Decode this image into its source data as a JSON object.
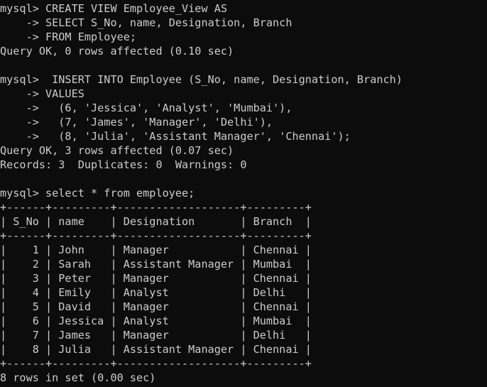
{
  "terminal": {
    "lines": [
      "mysql> CREATE VIEW Employee_View AS",
      "    -> SELECT S_No, name, Designation, Branch",
      "    -> FROM Employee;",
      "Query OK, 0 rows affected (0.10 sec)",
      "",
      "mysql>  INSERT INTO Employee (S_No, name, Designation, Branch)",
      "    -> VALUES",
      "    ->   (6, 'Jessica', 'Analyst', 'Mumbai'),",
      "    ->   (7, 'James', 'Manager', 'Delhi'),",
      "    ->   (8, 'Julia', 'Assistant Manager', 'Chennai');",
      "Query OK, 3 rows affected (0.07 sec)",
      "Records: 3  Duplicates: 0  Warnings: 0",
      "",
      "mysql> select * from employee;",
      "+------+---------+-------------------+---------+",
      "| S_No | name    | Designation       | Branch  |",
      "+------+---------+-------------------+---------+",
      "|    1 | John    | Manager           | Chennai |",
      "|    2 | Sarah   | Assistant Manager | Mumbai  |",
      "|    3 | Peter   | Manager           | Chennai |",
      "|    4 | Emily   | Analyst           | Delhi   |",
      "|    5 | David   | Manager           | Chennai |",
      "|    6 | Jessica | Analyst           | Mumbai  |",
      "|    7 | James   | Manager           | Delhi   |",
      "|    8 | Julia   | Assistant Manager | Chennai |",
      "+------+---------+-------------------+---------+",
      "8 rows in set (0.00 sec)"
    ]
  }
}
